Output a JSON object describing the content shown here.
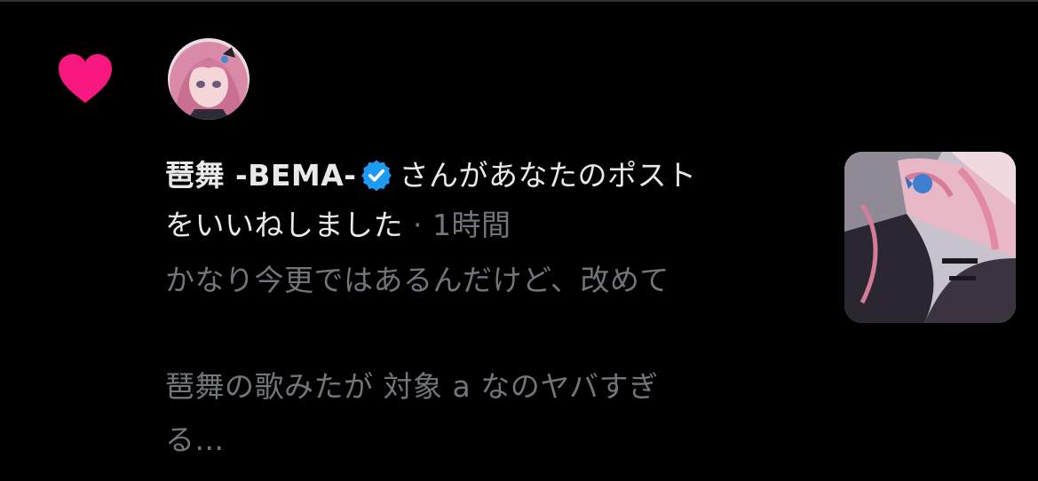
{
  "notification": {
    "type_icon": "heart-icon",
    "avatar_icon": "anime-avatar-image",
    "user_name": "琶舞 -BEMA-",
    "verified_icon": "verified-badge-icon",
    "action_line1": "さんがあなたのポスト",
    "action_line2": "をいいねしました",
    "separator": " · ",
    "time": "1時間",
    "preview_line1": "かなり今更ではあるんだけど、改めて",
    "preview_line2": "琶舞の歌みたが 対象 a なのヤバすぎ",
    "preview_line3": "る...",
    "thumbnail_icon": "post-media-thumbnail"
  },
  "colors": {
    "background": "#000000",
    "heart": "#f91880",
    "primary_text": "#e7e9ea",
    "secondary_text": "#71767b",
    "verified": "#1d9bf0"
  }
}
